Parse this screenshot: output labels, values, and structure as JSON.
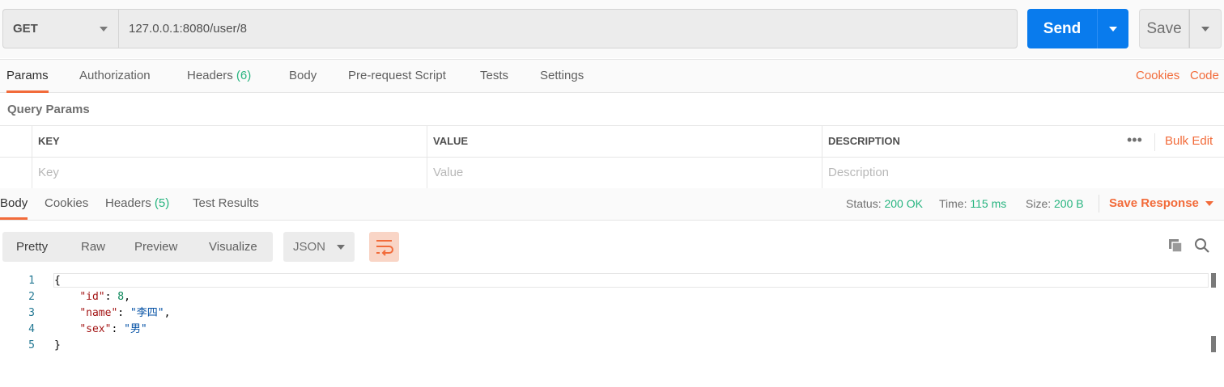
{
  "request": {
    "method": "GET",
    "url": "127.0.0.1:8080/user/8",
    "send_label": "Send",
    "save_label": "Save"
  },
  "request_tabs": [
    {
      "label": "Params",
      "count": ""
    },
    {
      "label": "Authorization",
      "count": ""
    },
    {
      "label": "Headers",
      "count": "(6)"
    },
    {
      "label": "Body",
      "count": ""
    },
    {
      "label": "Pre-request Script",
      "count": ""
    },
    {
      "label": "Tests",
      "count": ""
    },
    {
      "label": "Settings",
      "count": ""
    }
  ],
  "request_links": {
    "cookies": "Cookies",
    "code": "Code"
  },
  "query_params": {
    "title": "Query Params",
    "columns": {
      "key": "KEY",
      "value": "VALUE",
      "description": "DESCRIPTION"
    },
    "more": "•••",
    "bulk_edit": "Bulk Edit",
    "placeholders": {
      "key": "Key",
      "value": "Value",
      "description": "Description"
    }
  },
  "response_tabs": [
    {
      "label": "Body",
      "count": ""
    },
    {
      "label": "Cookies",
      "count": ""
    },
    {
      "label": "Headers",
      "count": "(5)"
    },
    {
      "label": "Test Results",
      "count": ""
    }
  ],
  "response_status": {
    "status_label": "Status:",
    "status_value": "200 OK",
    "time_label": "Time:",
    "time_value": "115 ms",
    "size_label": "Size:",
    "size_value": "200 B",
    "save_response": "Save Response"
  },
  "view_options": [
    "Pretty",
    "Raw",
    "Preview",
    "Visualize"
  ],
  "format": "JSON",
  "code": {
    "line_numbers": [
      "1",
      "2",
      "3",
      "4",
      "5"
    ],
    "open_brace": "{",
    "close_brace": "}",
    "fields": [
      {
        "key": "\"id\"",
        "value": "8",
        "type": "number",
        "comma": ","
      },
      {
        "key": "\"name\"",
        "value": "\"李四\"",
        "type": "string",
        "comma": ","
      },
      {
        "key": "\"sex\"",
        "value": "\"男\"",
        "type": "string",
        "comma": ""
      }
    ]
  },
  "colors": {
    "accent": "#f26b3a",
    "send_blue": "#097bed",
    "success_green": "#26b47f"
  }
}
